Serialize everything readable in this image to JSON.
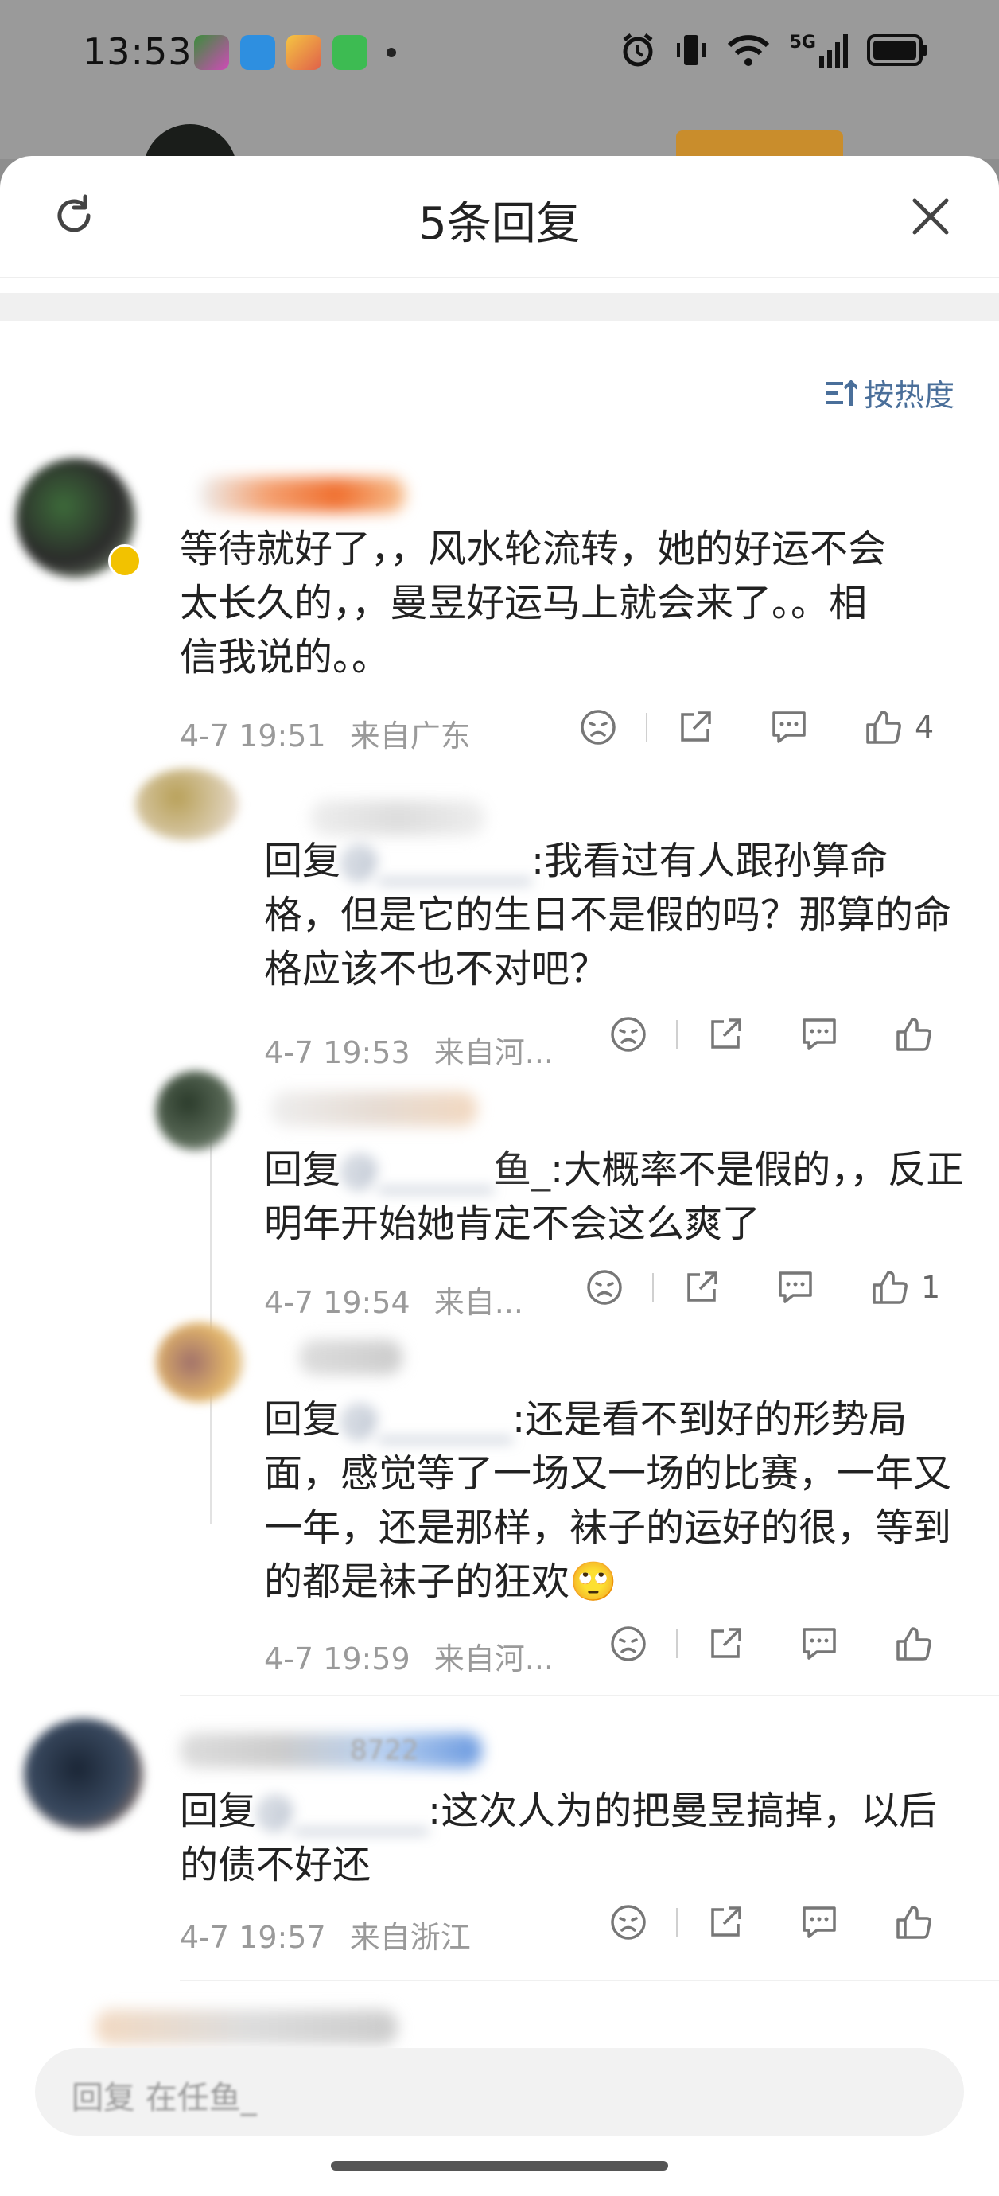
{
  "status_bar": {
    "time": "13:53",
    "network": "5G"
  },
  "sheet": {
    "title": "5条回复",
    "sort_label": "按热度"
  },
  "comments": [
    {
      "text": "等待就好了，，风水轮流转，她的好运不会太长久的，，曼昱好运马上就会来了。。相信我说的。。",
      "time": "4-7 19:51",
      "location": "来自广东",
      "likes": "4"
    },
    {
      "reply_prefix": "回复",
      "mention": "@",
      "text": ":我看过有人跟孙算命格，但是它的生日不是假的吗？那算的命格应该不也不对吧？",
      "time": "4-7 19:53",
      "location": "来自河...",
      "likes": ""
    },
    {
      "reply_prefix": "回复",
      "mention": "鱼_",
      "text": ":大概率不是假的，，反正明年开始她肯定不会这么爽了",
      "time": "4-7 19:54",
      "location": "来自...",
      "likes": "1"
    },
    {
      "reply_prefix": "回复",
      "mention": "@",
      "text": ":还是看不到好的形势局面，感觉等了一场又一场的比赛，一年又一年，还是那样，袜子的运好的很，等到的都是袜子的狂欢🙄",
      "time": "4-7 19:59",
      "location": "来自河...",
      "likes": ""
    },
    {
      "name_partial": "8722",
      "reply_prefix": "回复",
      "mention": "@",
      "text": ":这次人为的把曼昱搞掉，以后的债不好还",
      "time": "4-7 19:57",
      "location": "来自浙江",
      "likes": ""
    }
  ],
  "input": {
    "placeholder": "回复 在任鱼_"
  },
  "colors": {
    "accent": "#4a6f9a",
    "meta": "#9a9a9a",
    "text": "#222222"
  }
}
